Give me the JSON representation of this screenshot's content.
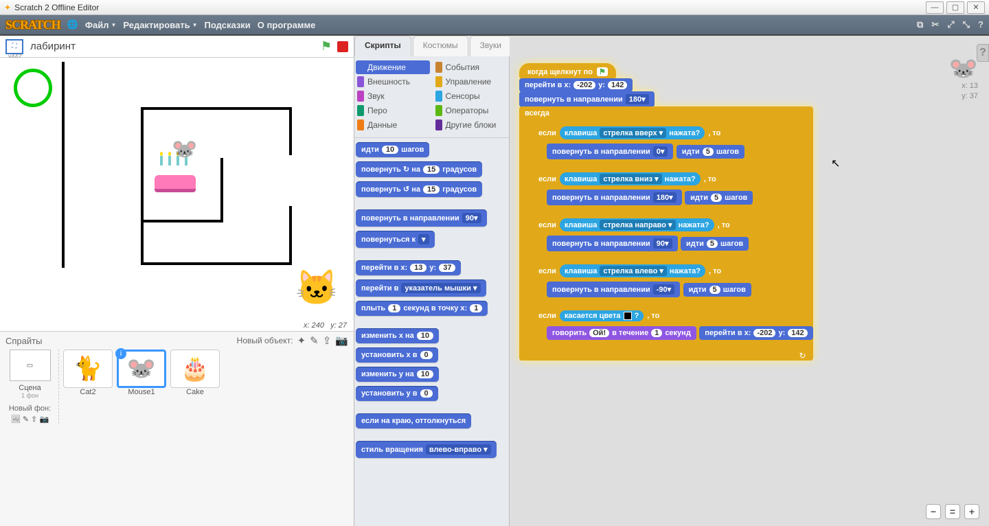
{
  "window": {
    "title": "Scratch 2 Offline Editor"
  },
  "topbar": {
    "logo": "SCRATCH",
    "menu": {
      "file": "Файл",
      "edit": "Редактировать",
      "tips": "Подсказки",
      "about": "О программе"
    }
  },
  "stage": {
    "project_name": "лабиринт",
    "y442": "y442",
    "coord_label_x": "x:",
    "coord_x": "240",
    "coord_label_y": "y:",
    "coord_y": "27"
  },
  "sprites": {
    "title": "Спрайты",
    "new_label": "Новый объект:",
    "stage_label": "Сцена",
    "backdrop_count": "1 фон",
    "new_backdrop": "Новый фон:",
    "items": [
      {
        "name": "Cat2",
        "emoji": "🐈"
      },
      {
        "name": "Mouse1",
        "emoji": "🐭"
      },
      {
        "name": "Cake",
        "emoji": "🎂"
      }
    ]
  },
  "tabs": {
    "scripts": "Скрипты",
    "costumes": "Костюмы",
    "sounds": "Звуки"
  },
  "categories": {
    "motion": "Движение",
    "looks": "Внешность",
    "sound": "Звук",
    "pen": "Перо",
    "data": "Данные",
    "events": "События",
    "control": "Управление",
    "sensing": "Сенсоры",
    "operators": "Операторы",
    "more": "Другие блоки"
  },
  "palette": {
    "move_a": "идти",
    "move_n": "10",
    "move_b": "шагов",
    "turncw_a": "повернуть ↻ на",
    "turncw_n": "15",
    "turncw_b": "градусов",
    "turnccw_a": "повернуть ↺ на",
    "turnccw_n": "15",
    "turnccw_b": "градусов",
    "point_dir_a": "повернуть в направлении",
    "point_dir_v": "90▾",
    "point_to_a": "повернуться к",
    "point_to_v": "▾",
    "goto_a": "перейти в x:",
    "goto_x": "13",
    "goto_b": "y:",
    "goto_y": "37",
    "goto_ptr_a": "перейти в",
    "goto_ptr_v": "указатель мышки ▾",
    "glide_a": "плыть",
    "glide_s": "1",
    "glide_b": "секунд в точку x:",
    "chx_a": "изменить x на",
    "chx_n": "10",
    "setx_a": "установить x в",
    "setx_n": "0",
    "chy_a": "изменить y на",
    "chy_n": "10",
    "sety_a": "установить y в",
    "sety_n": "0",
    "edge": "если на краю, оттолкнуться",
    "rot_a": "стиль вращения",
    "rot_v": "влево-вправо ▾"
  },
  "script": {
    "hat": "когда щелкнут по",
    "gotoA": "перейти в x:",
    "gotoX": "-202",
    "gotoB": "y:",
    "gotoY": "142",
    "pointA": "повернуть в направлении",
    "pointV": "180▾",
    "forever": "всегда",
    "if": "если",
    "then": ", то",
    "keyA": "клавиша",
    "pressed": "нажата?",
    "key_up": "стрелка вверх ▾",
    "key_down": "стрелка вниз ▾",
    "key_right": "стрелка направо ▾",
    "key_left": "стрелка влево ▾",
    "dir0": "0▾",
    "dir180": "180▾",
    "dir90": "90▾",
    "dirm90": "-90▾",
    "moveA": "идти",
    "moveN": "5",
    "moveB": "шагов",
    "touchColorA": "касается цвета",
    "touchColorQ": "?",
    "sayA": "говорить",
    "sayMsg": "Ой!",
    "sayB": "в течение",
    "sayS": "1",
    "sayC": "секунд",
    "goto2X": "-202",
    "goto2Y": "142"
  },
  "right": {
    "x_lbl": "x:",
    "x_val": "13",
    "y_lbl": "y:",
    "y_val": "37"
  }
}
